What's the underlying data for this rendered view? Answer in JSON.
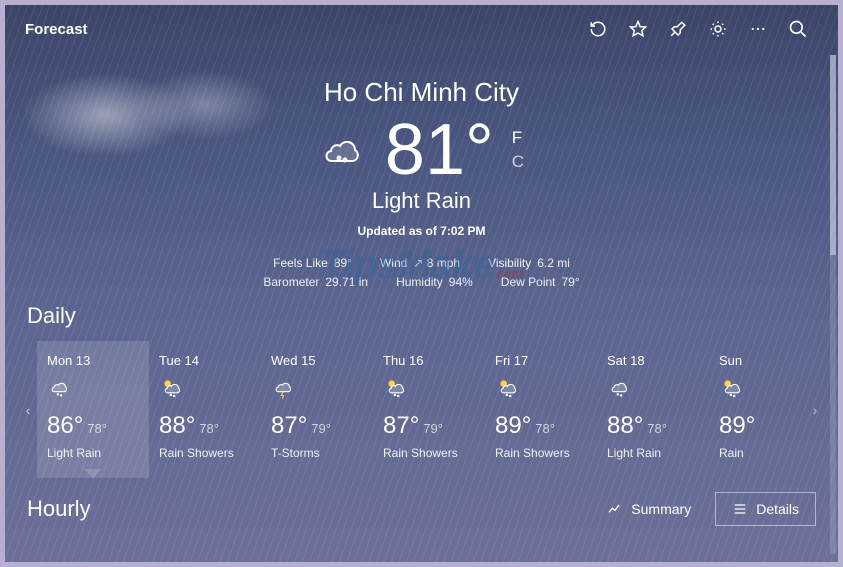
{
  "title_bar": {
    "title": "Forecast"
  },
  "current": {
    "city": "Ho Chi Minh City",
    "temp": "81°",
    "unit_f": "F",
    "unit_c": "C",
    "condition": "Light Rain",
    "updated": "Updated as of 7:02 PM",
    "metrics1": {
      "feels_like_lbl": "Feels Like",
      "feels_like_val": "89°",
      "wind_lbl": "Wind",
      "wind_val": "8 mph",
      "visibility_lbl": "Visibility",
      "visibility_val": "6.2 mi"
    },
    "metrics2": {
      "barometer_lbl": "Barometer",
      "barometer_val": "29.71 in",
      "humidity_lbl": "Humidity",
      "humidity_val": "94%",
      "dew_lbl": "Dew Point",
      "dew_val": "79°"
    }
  },
  "daily_label": "Daily",
  "hourly_label": "Hourly",
  "toggle": {
    "summary": "Summary",
    "details": "Details"
  },
  "daily": [
    {
      "name": "Mon 13",
      "hi": "86°",
      "lo": "78°",
      "cond": "Light Rain",
      "icon": "rain"
    },
    {
      "name": "Tue 14",
      "hi": "88°",
      "lo": "78°",
      "cond": "Rain Showers",
      "icon": "sun-rain"
    },
    {
      "name": "Wed 15",
      "hi": "87°",
      "lo": "79°",
      "cond": "T-Storms",
      "icon": "storm"
    },
    {
      "name": "Thu 16",
      "hi": "87°",
      "lo": "79°",
      "cond": "Rain Showers",
      "icon": "sun-rain"
    },
    {
      "name": "Fri 17",
      "hi": "89°",
      "lo": "78°",
      "cond": "Rain Showers",
      "icon": "sun-rain"
    },
    {
      "name": "Sat 18",
      "hi": "88°",
      "lo": "78°",
      "cond": "Light Rain",
      "icon": "rain"
    },
    {
      "name": "Sun",
      "hi": "89°",
      "lo": "",
      "cond": "Rain",
      "icon": "sun-rain"
    }
  ],
  "watermark": {
    "text": "TipsMake",
    "suffix": ".com"
  }
}
